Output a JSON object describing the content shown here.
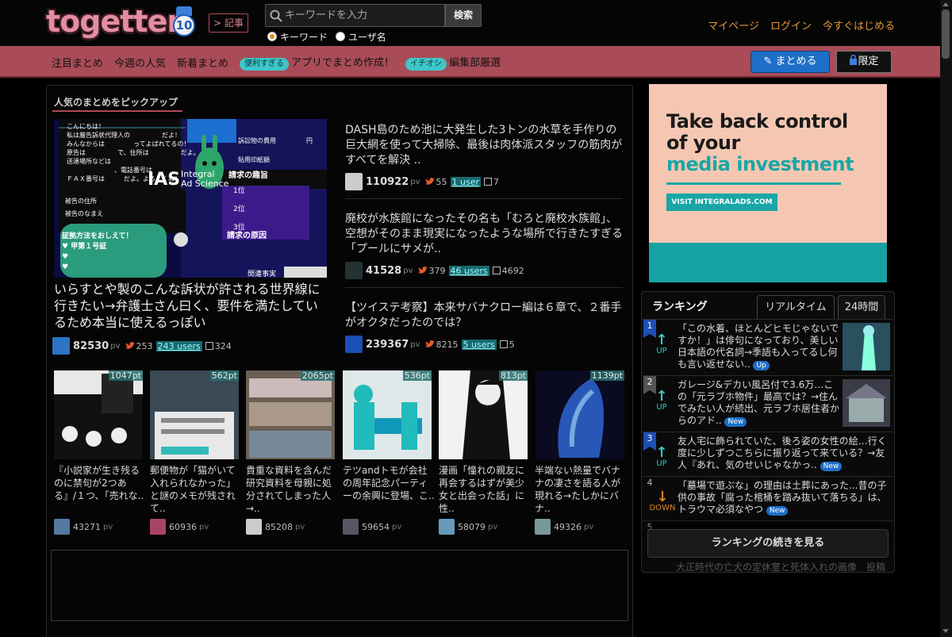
{
  "header": {
    "logo_text": "togetter",
    "logo_badge": "10",
    "kiji_label": "記事",
    "search_placeholder": "キーワードを入力",
    "search_button": "検索",
    "radio_keyword": "キーワード",
    "radio_user": "ユーザ名",
    "links": [
      "マイページ",
      "ログイン",
      "今すぐはじめる"
    ]
  },
  "nav": {
    "items": [
      "注目まとめ",
      "今週の人気",
      "新着まとめ"
    ],
    "pill1": "便利すぎる",
    "app_text": "アプリでまとめ作成！",
    "pill2": "イチオシ",
    "editor_text": "編集部厳選",
    "matome_btn": "まとめる",
    "gentei_btn": "限定"
  },
  "pickup": {
    "title": "人気のまとめをピックアップ",
    "hero": {
      "title": "いらすとや製のこんな訴状が許される世界線に行きたい→弁護士さん曰く、要件を満たしているため本当に使えるっぽい",
      "pv": "82530",
      "pv_label": "pv",
      "tweets": "253",
      "users": "243 users",
      "fav": "324"
    },
    "side": [
      {
        "title": "DASH島のため池に大発生した3トンの水草を手作りの巨大網を使って大掃除、最後は肉体派スタッフの筋肉がすべてを解決 ..",
        "pv": "110922",
        "tweets": "55",
        "users": "1 user",
        "fav": "7"
      },
      {
        "title": "廃校が水族館になったその名も「むろと廃校水族館」、空想がそのまま現実になったような場所で行きたすぎる「プールにサメが..",
        "pv": "41528",
        "tweets": "379",
        "users": "46 users",
        "fav": "4692"
      },
      {
        "title": "【ツイステ考察】本来サバナクロー編は６章で、２番手がオクタだったのでは？",
        "pv": "239367",
        "tweets": "8215",
        "users": "5 users",
        "fav": "5"
      }
    ],
    "thumbs": [
      {
        "pt": "1047pt",
        "title": "『小説家が生き残るのに禁句が2つある』/１つ、「売れな..",
        "pv": "43271"
      },
      {
        "pt": "562pt",
        "title": "郵便物が「猫がいて入れられなかった」と謎のメモが残されて..",
        "pv": "60936"
      },
      {
        "pt": "2065pt",
        "title": "貴重な資料を含んだ研究資料を母親に処分されてしまった人→..",
        "pv": "85208"
      },
      {
        "pt": "536pt",
        "title": "テツandトモが会社の周年記念パーティーの余興に登場、こ..",
        "pv": "59654"
      },
      {
        "pt": "813pt",
        "title": "漫画「憧れの親友に再会するはずが美少女と出会った話」に性..",
        "pv": "58079"
      },
      {
        "pt": "1139pt",
        "title": "半端ない熱量でバナナの凄さを語る人が現れる→たしかにバナ..",
        "pv": "49326"
      }
    ]
  },
  "hero_image_text": {
    "greeting": "こんにちは！",
    "lines": [
      "私は厳告訴状代理人の",
      "みんなからは",
      "原告は",
      "送達場所などは",
      "ＦＡＸ番号は",
      "被告の住所",
      "被告のなまえ"
    ],
    "tail1": "だよ！",
    "tail2": "ってよばれてるの！",
    "tail3": "で、住所は",
    "tail4": "だよ。",
    "tail5": "、電話番号は",
    "tail6": "だよ。よろしくね！",
    "fee1": "訴訟物の費用",
    "fee2": "貼用印紙額",
    "yen": "円",
    "purpose": "請求の趣旨",
    "ranks": [
      "1位",
      "2位",
      "3位"
    ],
    "cause": "請求の原因",
    "proof": "証拠方法をおしえて！",
    "evidence": "♥ 甲第１号証",
    "heart": "♥",
    "related": "関連事実"
  },
  "ad": {
    "line1": "Take back control",
    "line2": "of your",
    "line3": "media investment",
    "cta": "VISIT INTEGRALADS.COM",
    "logo": "IAS",
    "logo_sub1": "Integral",
    "logo_sub2": "Ad Science"
  },
  "ranking": {
    "title": "ランキング",
    "tab_realtime": "リアルタイム",
    "tab_24h": "24時間",
    "up": "UP",
    "down": "DOWN",
    "new_tag": "New",
    "up_tag": "Up",
    "rows": [
      {
        "rank": "1",
        "text": "「この水着、ほとんどヒモじゃないですか！」は俳句になっており、美しい日本語の代名詞→季語も入ってるし何も言い返せない.."
      },
      {
        "rank": "2",
        "text": "ガレージ&デカい風呂付で3.6万…この「元ラブホ物件」最高では？→住んでみたい人が続出、元ラブホ居住者からのアド.."
      },
      {
        "rank": "3",
        "text": "友人宅に飾られていた、後ろ姿の女性の絵…行く度に少しずつこちらに振り返って来ている？→友人『あれ、気のせいじゃなかっ.."
      },
      {
        "rank": "4",
        "text": "「墓場で遊ぶな」の理由は土葬にあった...昔の子供の事故「腐った棺桶を踏み抜いて落ちる」は、トラウマ必須なやつ"
      },
      {
        "rank": "5",
        "text": ""
      }
    ],
    "more": "ランキングの続きを見る",
    "faded": "大正時代の亡犬の定休室と死体入れの画像　投稿"
  }
}
